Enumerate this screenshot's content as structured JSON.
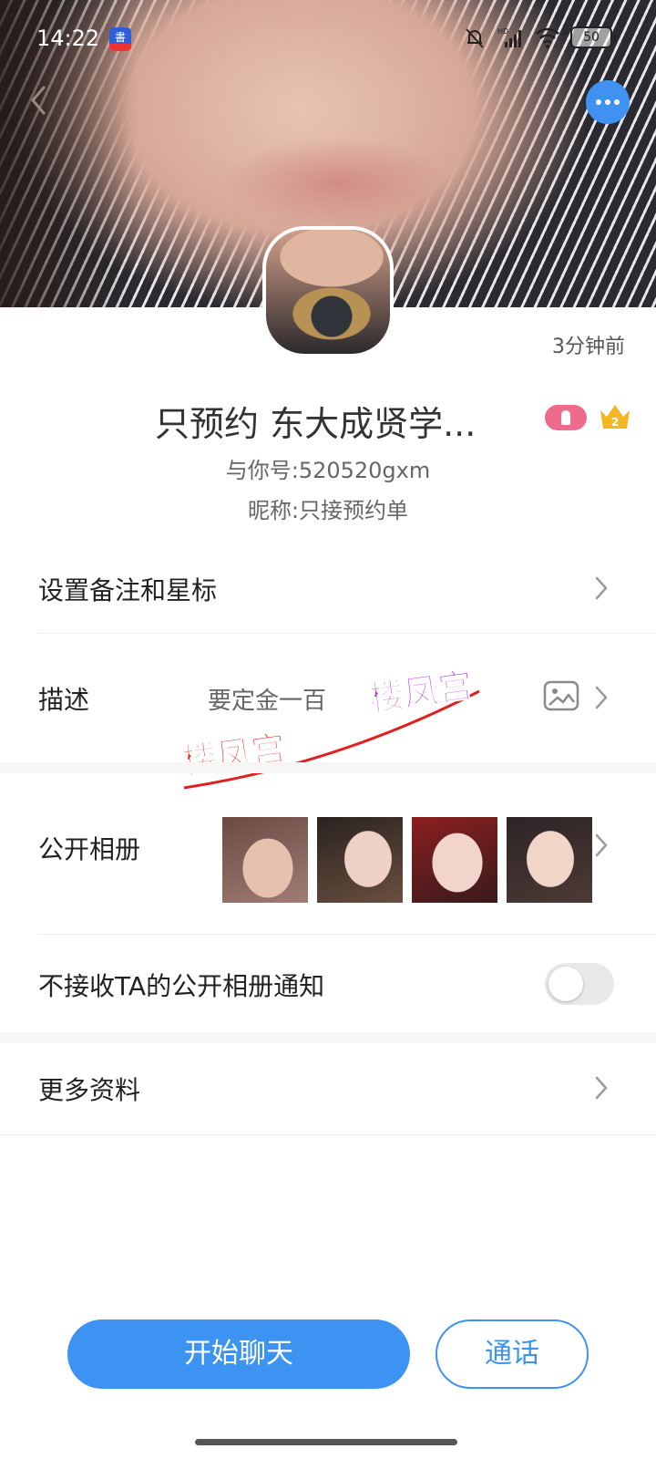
{
  "status_bar": {
    "time": "14:22",
    "battery": "50"
  },
  "cover": {
    "icons": [
      "back-arrow-icon",
      "more-dots-icon"
    ]
  },
  "profile": {
    "time_ago": "3分钟前",
    "name": "只预约 东大成贤学...",
    "id_label": "与你号:520520gxm",
    "nickname": "昵称:只接预约单",
    "badges": [
      "female-badge-icon",
      "crown-level-icon"
    ],
    "level": "2"
  },
  "menu": {
    "remark": {
      "label": "设置备注和星标"
    },
    "description": {
      "label": "描述",
      "value": "要定金一百"
    },
    "album": {
      "label": "公开相册",
      "photo_count": 4
    },
    "album_notify": {
      "label": "不接收TA的公开相册通知",
      "enabled": false
    },
    "more_info": {
      "label": "更多资料"
    }
  },
  "watermark": {
    "text": "楼凤宫"
  },
  "actions": {
    "chat": "开始聊天",
    "call": "通话"
  },
  "colors": {
    "accent": "#3d93f1",
    "badge_pink": "#ef6b8e",
    "crown": "#f5b623"
  }
}
